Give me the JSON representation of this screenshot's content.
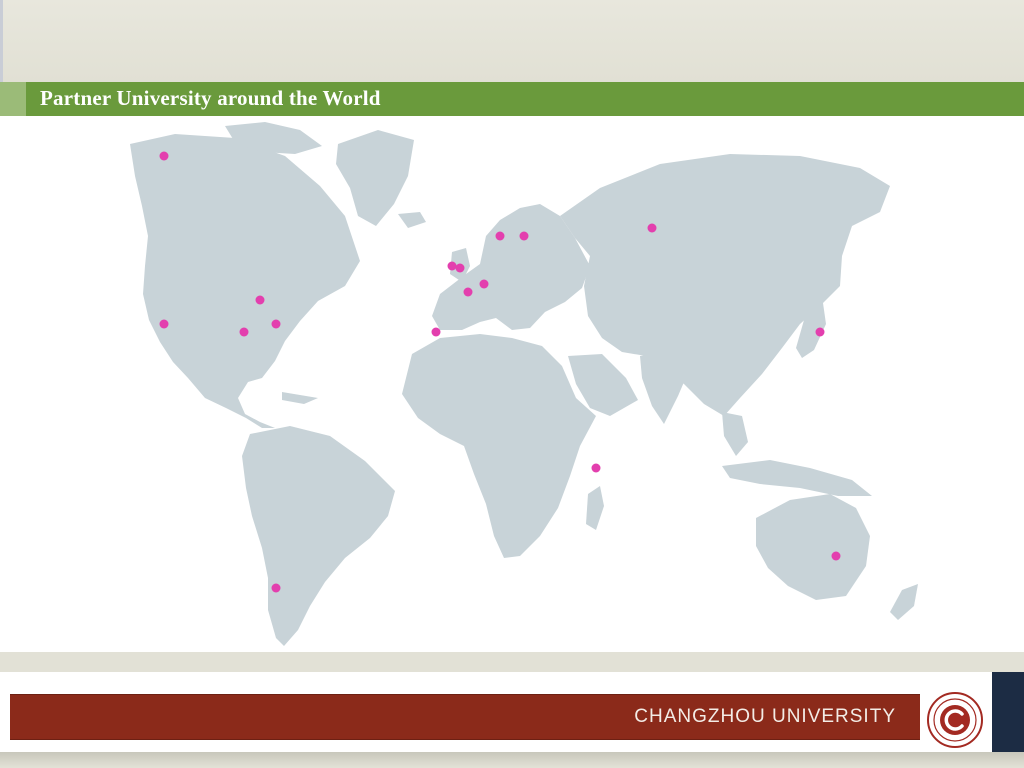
{
  "slide": {
    "title": "Partner University around the World"
  },
  "footer": {
    "university_name": "CHANGZHOU UNIVERSITY"
  },
  "colors": {
    "title_bar": "#6a9a3c",
    "footer_bar": "#8b2a1a",
    "land": "#c8d3d8",
    "marker": "#e33fae"
  }
}
